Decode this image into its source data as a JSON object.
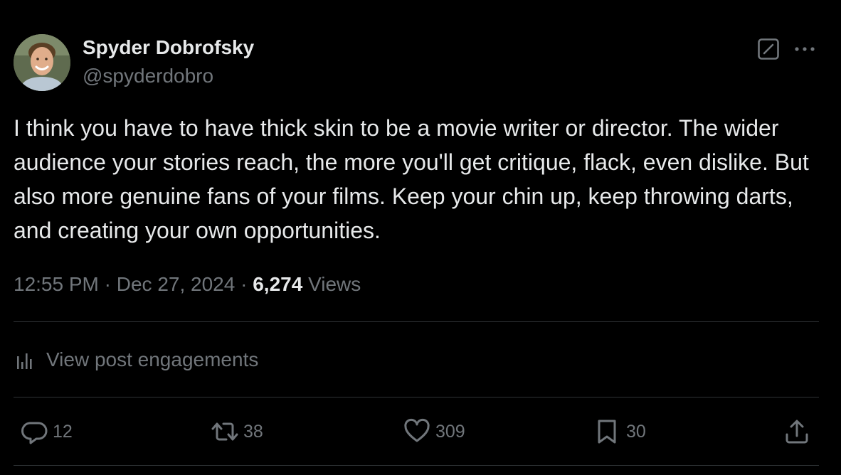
{
  "author": {
    "display_name": "Spyder Dobrofsky",
    "handle": "@spyderdobro",
    "avatar_icon": "profile-photo"
  },
  "header_actions": {
    "grok_icon": "grok-icon",
    "more_icon": "more-horizontal-icon"
  },
  "post": {
    "text": "I think you have to have thick skin to be a movie writer or director. The wider audience your stories reach, the more you'll get critique, flack, even dislike. But also more genuine fans of your films. Keep your chin up, keep throwing darts, and creating your own opportunities."
  },
  "meta": {
    "time": "12:55 PM",
    "separator": "·",
    "date": "Dec 27, 2024",
    "views_count": "6,274",
    "views_label": "Views"
  },
  "engagements": {
    "icon": "analytics-icon",
    "label": "View post engagements"
  },
  "actions": {
    "replies": {
      "icon": "reply-icon",
      "count": "12"
    },
    "reposts": {
      "icon": "repost-icon",
      "count": "38"
    },
    "likes": {
      "icon": "like-icon",
      "count": "309"
    },
    "bookmarks": {
      "icon": "bookmark-icon",
      "count": "30"
    },
    "share": {
      "icon": "share-icon"
    }
  },
  "colors": {
    "background": "#000000",
    "primary_text": "#e7e9ea",
    "secondary_text": "#71767b",
    "divider": "#2f3336"
  }
}
